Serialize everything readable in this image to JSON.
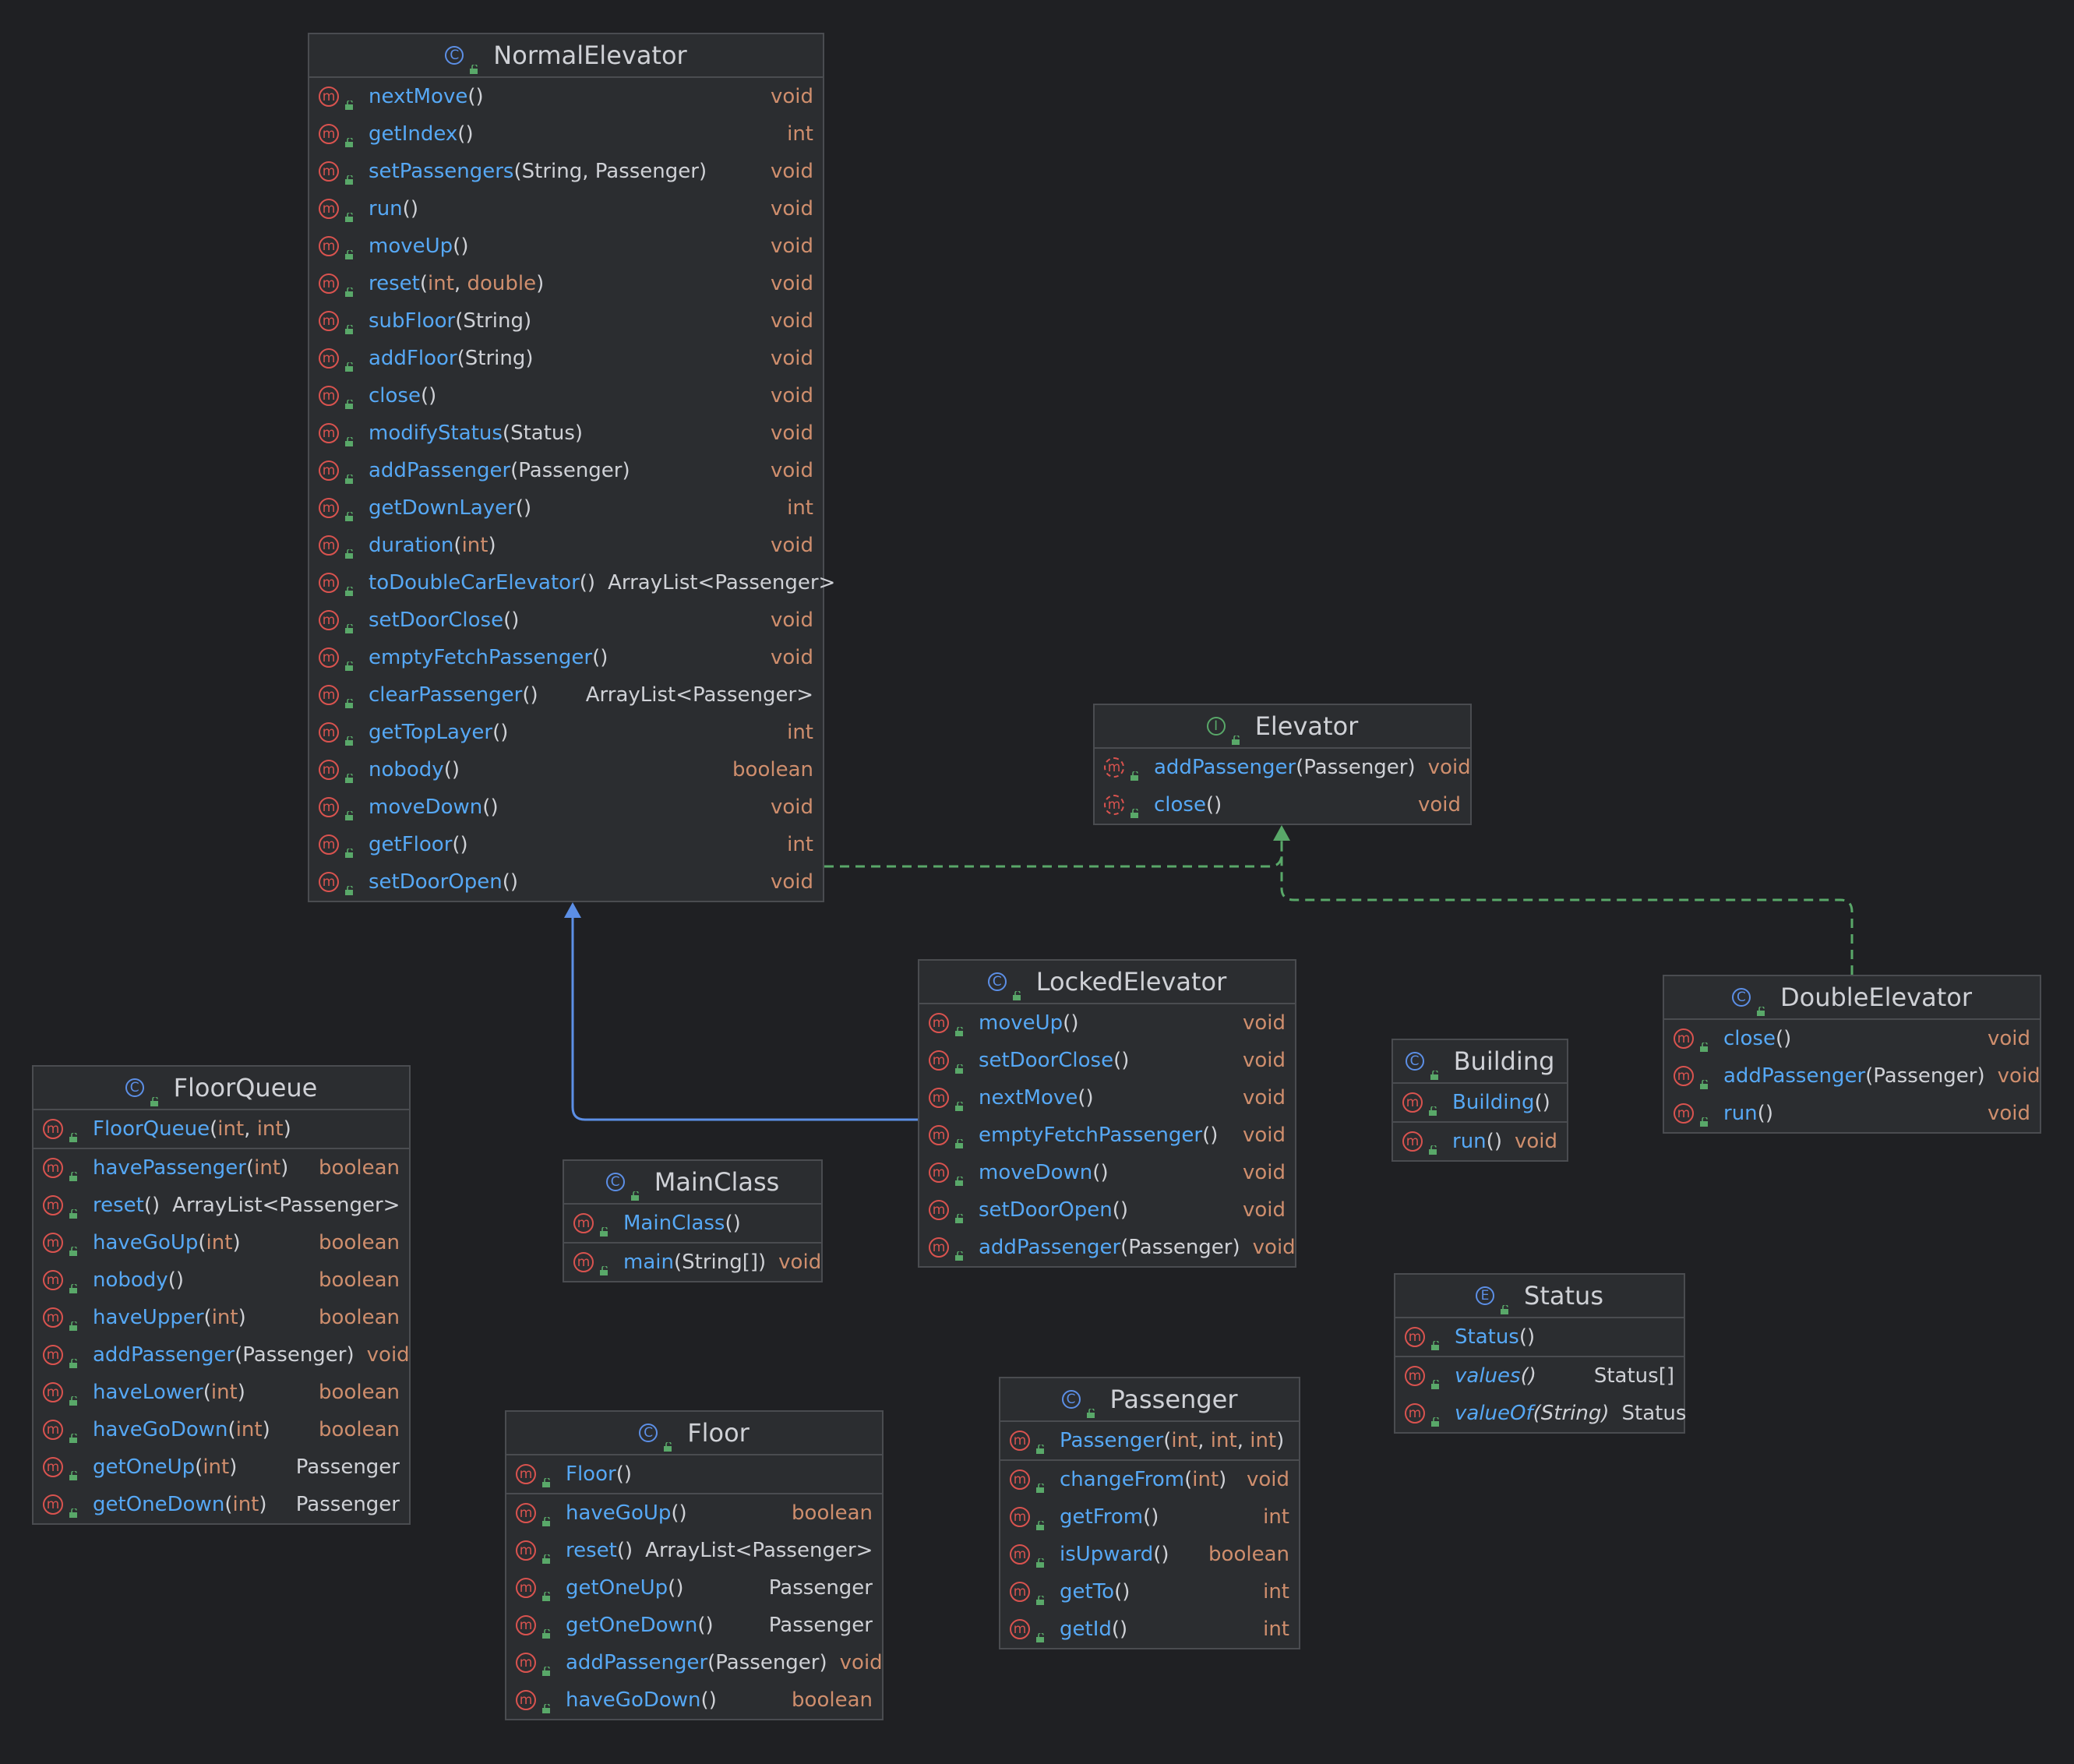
{
  "colors": {
    "background": "#1f2023",
    "box": "#2b2d30",
    "border": "#4a4c50",
    "method_name": "#56a8f5",
    "primitive": "#cf8e6d",
    "text": "#cfd1d6",
    "method_icon": "#d9534f",
    "class_icon": "#5c8fe6",
    "interface_icon": "#59a869",
    "inheritance_edge": "#5c8fe6",
    "realization_edge": "#59a869"
  },
  "icons": {
    "class": "C",
    "interface": "I",
    "enum": "E",
    "method": "m",
    "public": "lock-open-icon"
  },
  "classes": [
    {
      "id": "NormalElevator",
      "kind": "class",
      "title": "NormalElevator",
      "sections": [
        [
          {
            "name": "nextMove",
            "params": [],
            "ret": "void"
          },
          {
            "name": "getIndex",
            "params": [],
            "ret": "int"
          },
          {
            "name": "setPassengers",
            "params": [
              "String",
              "Passenger"
            ],
            "ret": "void"
          },
          {
            "name": "run",
            "params": [],
            "ret": "void"
          },
          {
            "name": "moveUp",
            "params": [],
            "ret": "void"
          },
          {
            "name": "reset",
            "params": [
              "int",
              "double"
            ],
            "ret": "void"
          },
          {
            "name": "subFloor",
            "params": [
              "String"
            ],
            "ret": "void"
          },
          {
            "name": "addFloor",
            "params": [
              "String"
            ],
            "ret": "void"
          },
          {
            "name": "close",
            "params": [],
            "ret": "void"
          },
          {
            "name": "modifyStatus",
            "params": [
              "Status"
            ],
            "ret": "void"
          },
          {
            "name": "addPassenger",
            "params": [
              "Passenger"
            ],
            "ret": "void"
          },
          {
            "name": "getDownLayer",
            "params": [],
            "ret": "int"
          },
          {
            "name": "duration",
            "params": [
              "int"
            ],
            "ret": "void"
          },
          {
            "name": "toDoubleCarElevator",
            "params": [],
            "ret": "ArrayList<Passenger>"
          },
          {
            "name": "setDoorClose",
            "params": [],
            "ret": "void"
          },
          {
            "name": "emptyFetchPassenger",
            "params": [],
            "ret": "void"
          },
          {
            "name": "clearPassenger",
            "params": [],
            "ret": "ArrayList<Passenger>"
          },
          {
            "name": "getTopLayer",
            "params": [],
            "ret": "int"
          },
          {
            "name": "nobody",
            "params": [],
            "ret": "boolean"
          },
          {
            "name": "moveDown",
            "params": [],
            "ret": "void"
          },
          {
            "name": "getFloor",
            "params": [],
            "ret": "int"
          },
          {
            "name": "setDoorOpen",
            "params": [],
            "ret": "void"
          }
        ]
      ]
    },
    {
      "id": "Elevator",
      "kind": "interface",
      "title": "Elevator",
      "sections": [
        [
          {
            "name": "addPassenger",
            "params": [
              "Passenger"
            ],
            "ret": "void",
            "abstract": true
          },
          {
            "name": "close",
            "params": [],
            "ret": "void",
            "abstract": true
          }
        ]
      ]
    },
    {
      "id": "LockedElevator",
      "kind": "class",
      "title": "LockedElevator",
      "sections": [
        [
          {
            "name": "moveUp",
            "params": [],
            "ret": "void"
          },
          {
            "name": "setDoorClose",
            "params": [],
            "ret": "void"
          },
          {
            "name": "nextMove",
            "params": [],
            "ret": "void"
          },
          {
            "name": "emptyFetchPassenger",
            "params": [],
            "ret": "void"
          },
          {
            "name": "moveDown",
            "params": [],
            "ret": "void"
          },
          {
            "name": "setDoorOpen",
            "params": [],
            "ret": "void"
          },
          {
            "name": "addPassenger",
            "params": [
              "Passenger"
            ],
            "ret": "void"
          }
        ]
      ]
    },
    {
      "id": "DoubleElevator",
      "kind": "class",
      "title": "DoubleElevator",
      "sections": [
        [
          {
            "name": "close",
            "params": [],
            "ret": "void"
          },
          {
            "name": "addPassenger",
            "params": [
              "Passenger"
            ],
            "ret": "void"
          },
          {
            "name": "run",
            "params": [],
            "ret": "void"
          }
        ]
      ]
    },
    {
      "id": "Building",
      "kind": "class",
      "title": "Building",
      "sections": [
        [
          {
            "name": "Building",
            "params": [],
            "ret": ""
          }
        ],
        [
          {
            "name": "run",
            "params": [],
            "ret": "void"
          }
        ]
      ]
    },
    {
      "id": "FloorQueue",
      "kind": "class",
      "title": "FloorQueue",
      "sections": [
        [
          {
            "name": "FloorQueue",
            "params": [
              "int",
              "int"
            ],
            "ret": ""
          }
        ],
        [
          {
            "name": "havePassenger",
            "params": [
              "int"
            ],
            "ret": "boolean"
          },
          {
            "name": "reset",
            "params": [],
            "ret": "ArrayList<Passenger>"
          },
          {
            "name": "haveGoUp",
            "params": [
              "int"
            ],
            "ret": "boolean"
          },
          {
            "name": "nobody",
            "params": [],
            "ret": "boolean"
          },
          {
            "name": "haveUpper",
            "params": [
              "int"
            ],
            "ret": "boolean"
          },
          {
            "name": "addPassenger",
            "params": [
              "Passenger"
            ],
            "ret": "void"
          },
          {
            "name": "haveLower",
            "params": [
              "int"
            ],
            "ret": "boolean"
          },
          {
            "name": "haveGoDown",
            "params": [
              "int"
            ],
            "ret": "boolean"
          },
          {
            "name": "getOneUp",
            "params": [
              "int"
            ],
            "ret": "Passenger"
          },
          {
            "name": "getOneDown",
            "params": [
              "int"
            ],
            "ret": "Passenger"
          }
        ]
      ]
    },
    {
      "id": "MainClass",
      "kind": "class",
      "title": "MainClass",
      "sections": [
        [
          {
            "name": "MainClass",
            "params": [],
            "ret": ""
          }
        ],
        [
          {
            "name": "main",
            "params": [
              "String[]"
            ],
            "ret": "void"
          }
        ]
      ]
    },
    {
      "id": "Status",
      "kind": "enum",
      "title": "Status",
      "sections": [
        [
          {
            "name": "Status",
            "params": [],
            "ret": ""
          }
        ],
        [
          {
            "name": "values",
            "params": [],
            "ret": "Status[]",
            "italic": true
          },
          {
            "name": "valueOf",
            "params": [
              "String"
            ],
            "ret": "Status",
            "italic": true
          }
        ]
      ]
    },
    {
      "id": "Floor",
      "kind": "class",
      "title": "Floor",
      "sections": [
        [
          {
            "name": "Floor",
            "params": [],
            "ret": ""
          }
        ],
        [
          {
            "name": "haveGoUp",
            "params": [],
            "ret": "boolean"
          },
          {
            "name": "reset",
            "params": [],
            "ret": "ArrayList<Passenger>"
          },
          {
            "name": "getOneUp",
            "params": [],
            "ret": "Passenger"
          },
          {
            "name": "getOneDown",
            "params": [],
            "ret": "Passenger"
          },
          {
            "name": "addPassenger",
            "params": [
              "Passenger"
            ],
            "ret": "void"
          },
          {
            "name": "haveGoDown",
            "params": [],
            "ret": "boolean"
          }
        ]
      ]
    },
    {
      "id": "Passenger",
      "kind": "class",
      "title": "Passenger",
      "sections": [
        [
          {
            "name": "Passenger",
            "params": [
              "int",
              "int",
              "int"
            ],
            "ret": ""
          }
        ],
        [
          {
            "name": "changeFrom",
            "params": [
              "int"
            ],
            "ret": "void"
          },
          {
            "name": "getFrom",
            "params": [],
            "ret": "int"
          },
          {
            "name": "isUpward",
            "params": [],
            "ret": "boolean"
          },
          {
            "name": "getTo",
            "params": [],
            "ret": "int"
          },
          {
            "name": "getId",
            "params": [],
            "ret": "int"
          }
        ]
      ]
    }
  ],
  "edges": [
    {
      "from": "LockedElevator",
      "to": "NormalElevator",
      "type": "extends"
    },
    {
      "from": "NormalElevator",
      "to": "Elevator",
      "type": "implements"
    },
    {
      "from": "DoubleElevator",
      "to": "Elevator",
      "type": "implements"
    }
  ]
}
